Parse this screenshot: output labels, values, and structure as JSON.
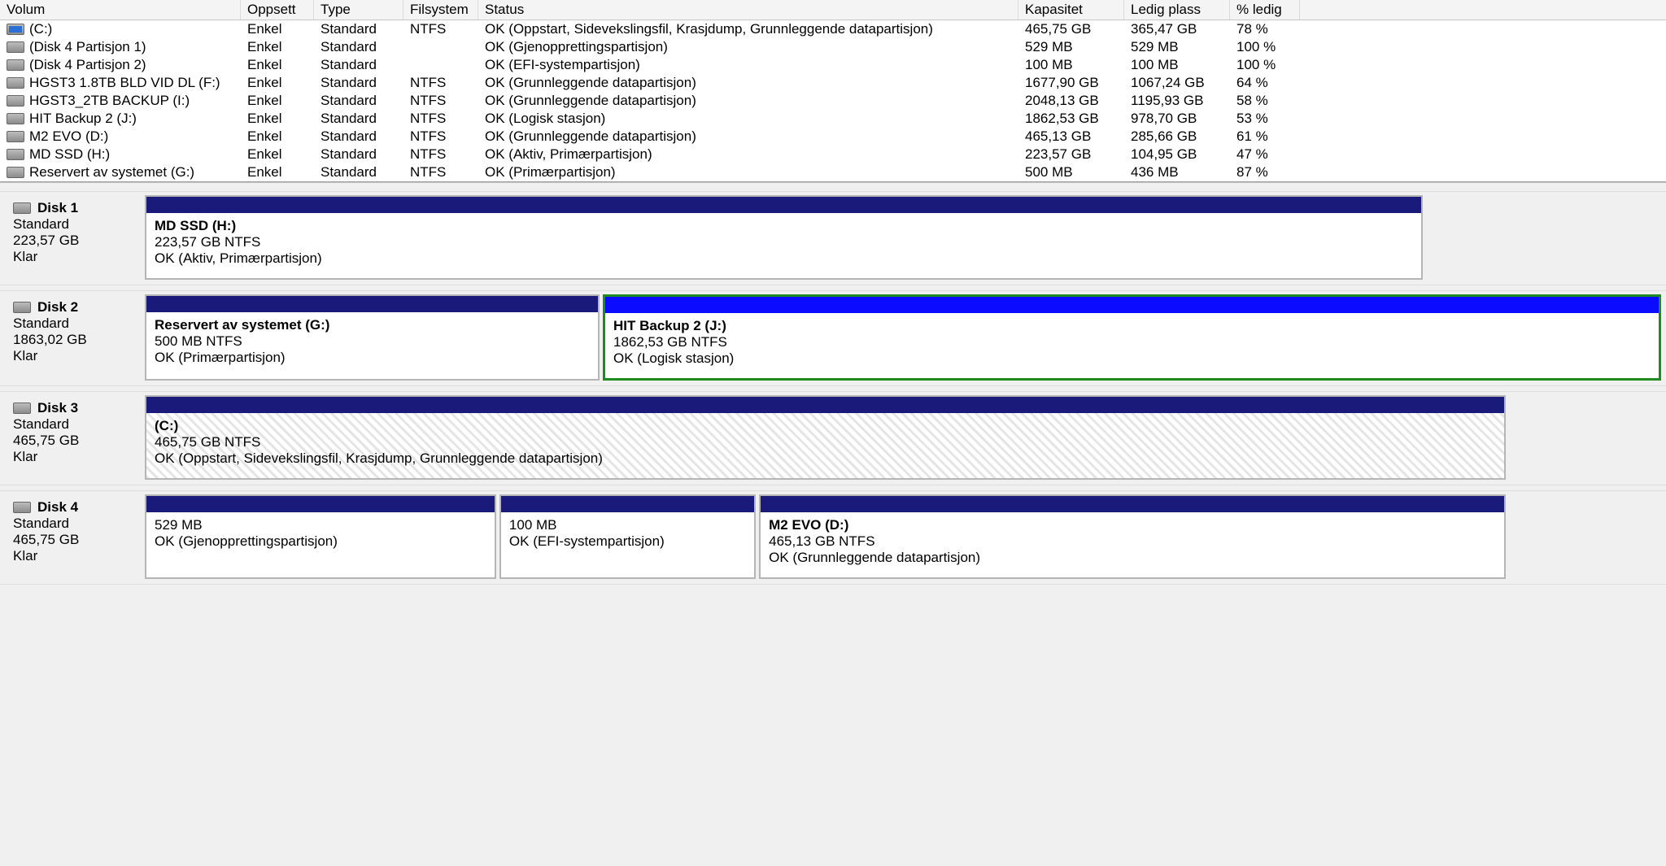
{
  "columns": {
    "volume": "Volum",
    "layout": "Oppsett",
    "type": "Type",
    "filesystem": "Filsystem",
    "status": "Status",
    "capacity": "Kapasitet",
    "free": "Ledig plass",
    "pctfree": "% ledig"
  },
  "volumes": [
    {
      "icon": "blue",
      "name": " (C:)",
      "layout": "Enkel",
      "type": "Standard",
      "fs": "NTFS",
      "status": "OK (Oppstart, Sidevekslingsfil, Krasjdump, Grunnleggende datapartisjon)",
      "cap": "465,75 GB",
      "free": "365,47 GB",
      "pct": "78 %"
    },
    {
      "icon": "grey",
      "name": " (Disk 4 Partisjon 1)",
      "layout": "Enkel",
      "type": "Standard",
      "fs": "",
      "status": "OK (Gjenopprettingspartisjon)",
      "cap": "529 MB",
      "free": "529 MB",
      "pct": "100 %"
    },
    {
      "icon": "grey",
      "name": " (Disk 4 Partisjon 2)",
      "layout": "Enkel",
      "type": "Standard",
      "fs": "",
      "status": "OK (EFI-systempartisjon)",
      "cap": "100 MB",
      "free": "100 MB",
      "pct": "100 %"
    },
    {
      "icon": "grey",
      "name": " HGST3 1.8TB BLD VID DL (F:)",
      "layout": "Enkel",
      "type": "Standard",
      "fs": "NTFS",
      "status": "OK (Grunnleggende datapartisjon)",
      "cap": "1677,90 GB",
      "free": "1067,24 GB",
      "pct": "64 %"
    },
    {
      "icon": "grey",
      "name": " HGST3_2TB BACKUP (I:)",
      "layout": "Enkel",
      "type": "Standard",
      "fs": "NTFS",
      "status": "OK (Grunnleggende datapartisjon)",
      "cap": "2048,13 GB",
      "free": "1195,93 GB",
      "pct": "58 %"
    },
    {
      "icon": "grey",
      "name": " HIT Backup 2 (J:)",
      "layout": "Enkel",
      "type": "Standard",
      "fs": "NTFS",
      "status": "OK (Logisk stasjon)",
      "cap": "1862,53 GB",
      "free": "978,70 GB",
      "pct": "53 %"
    },
    {
      "icon": "grey",
      "name": " M2 EVO (D:)",
      "layout": "Enkel",
      "type": "Standard",
      "fs": "NTFS",
      "status": "OK (Grunnleggende datapartisjon)",
      "cap": "465,13 GB",
      "free": "285,66 GB",
      "pct": "61 %"
    },
    {
      "icon": "grey",
      "name": " MD SSD (H:)",
      "layout": "Enkel",
      "type": "Standard",
      "fs": "NTFS",
      "status": "OK (Aktiv, Primærpartisjon)",
      "cap": "223,57 GB",
      "free": "104,95 GB",
      "pct": "47 %"
    },
    {
      "icon": "grey",
      "name": " Reservert av systemet (G:)",
      "layout": "Enkel",
      "type": "Standard",
      "fs": "NTFS",
      "status": "OK (Primærpartisjon)",
      "cap": "500 MB",
      "free": "436 MB",
      "pct": "87 %"
    }
  ],
  "disks": [
    {
      "name": "Disk 1",
      "type": "Standard",
      "size": "223,57 GB",
      "state": "Klar",
      "widthPct": 77,
      "partitions": [
        {
          "title": "MD SSD  (H:)",
          "line1": "223,57 GB NTFS",
          "line2": "OK (Aktiv, Primærpartisjon)",
          "flex": 1,
          "style": "normal"
        }
      ]
    },
    {
      "name": "Disk 2",
      "type": "Standard",
      "size": "1863,02 GB",
      "state": "Klar",
      "widthPct": 100,
      "partitions": [
        {
          "title": "Reservert av systemet  (G:)",
          "line1": "500 MB NTFS",
          "line2": "OK (Primærpartisjon)",
          "flex": 27,
          "style": "normal"
        },
        {
          "title": "HIT Backup 2  (J:)",
          "line1": "1862,53 GB NTFS",
          "line2": "OK (Logisk stasjon)",
          "flex": 63,
          "style": "selected bright"
        }
      ]
    },
    {
      "name": "Disk 3",
      "type": "Standard",
      "size": "465,75 GB",
      "state": "Klar",
      "widthPct": 82,
      "partitions": [
        {
          "title": " (C:)",
          "line1": "465,75 GB NTFS",
          "line2": "OK (Oppstart, Sidevekslingsfil, Krasjdump, Grunnleggende datapartisjon)",
          "flex": 1,
          "style": "hatched"
        }
      ]
    },
    {
      "name": "Disk 4",
      "type": "Standard",
      "size": "465,75 GB",
      "state": "Klar",
      "widthPct": 82,
      "partitions": [
        {
          "title": "",
          "line1": "529 MB",
          "line2": "OK (Gjenopprettingspartisjon)",
          "flex": 22,
          "style": "normal"
        },
        {
          "title": "",
          "line1": "100 MB",
          "line2": "OK (EFI-systempartisjon)",
          "flex": 16,
          "style": "normal"
        },
        {
          "title": "M2 EVO  (D:)",
          "line1": "465,13 GB NTFS",
          "line2": "OK (Grunnleggende datapartisjon)",
          "flex": 47,
          "style": "normal"
        }
      ]
    }
  ]
}
